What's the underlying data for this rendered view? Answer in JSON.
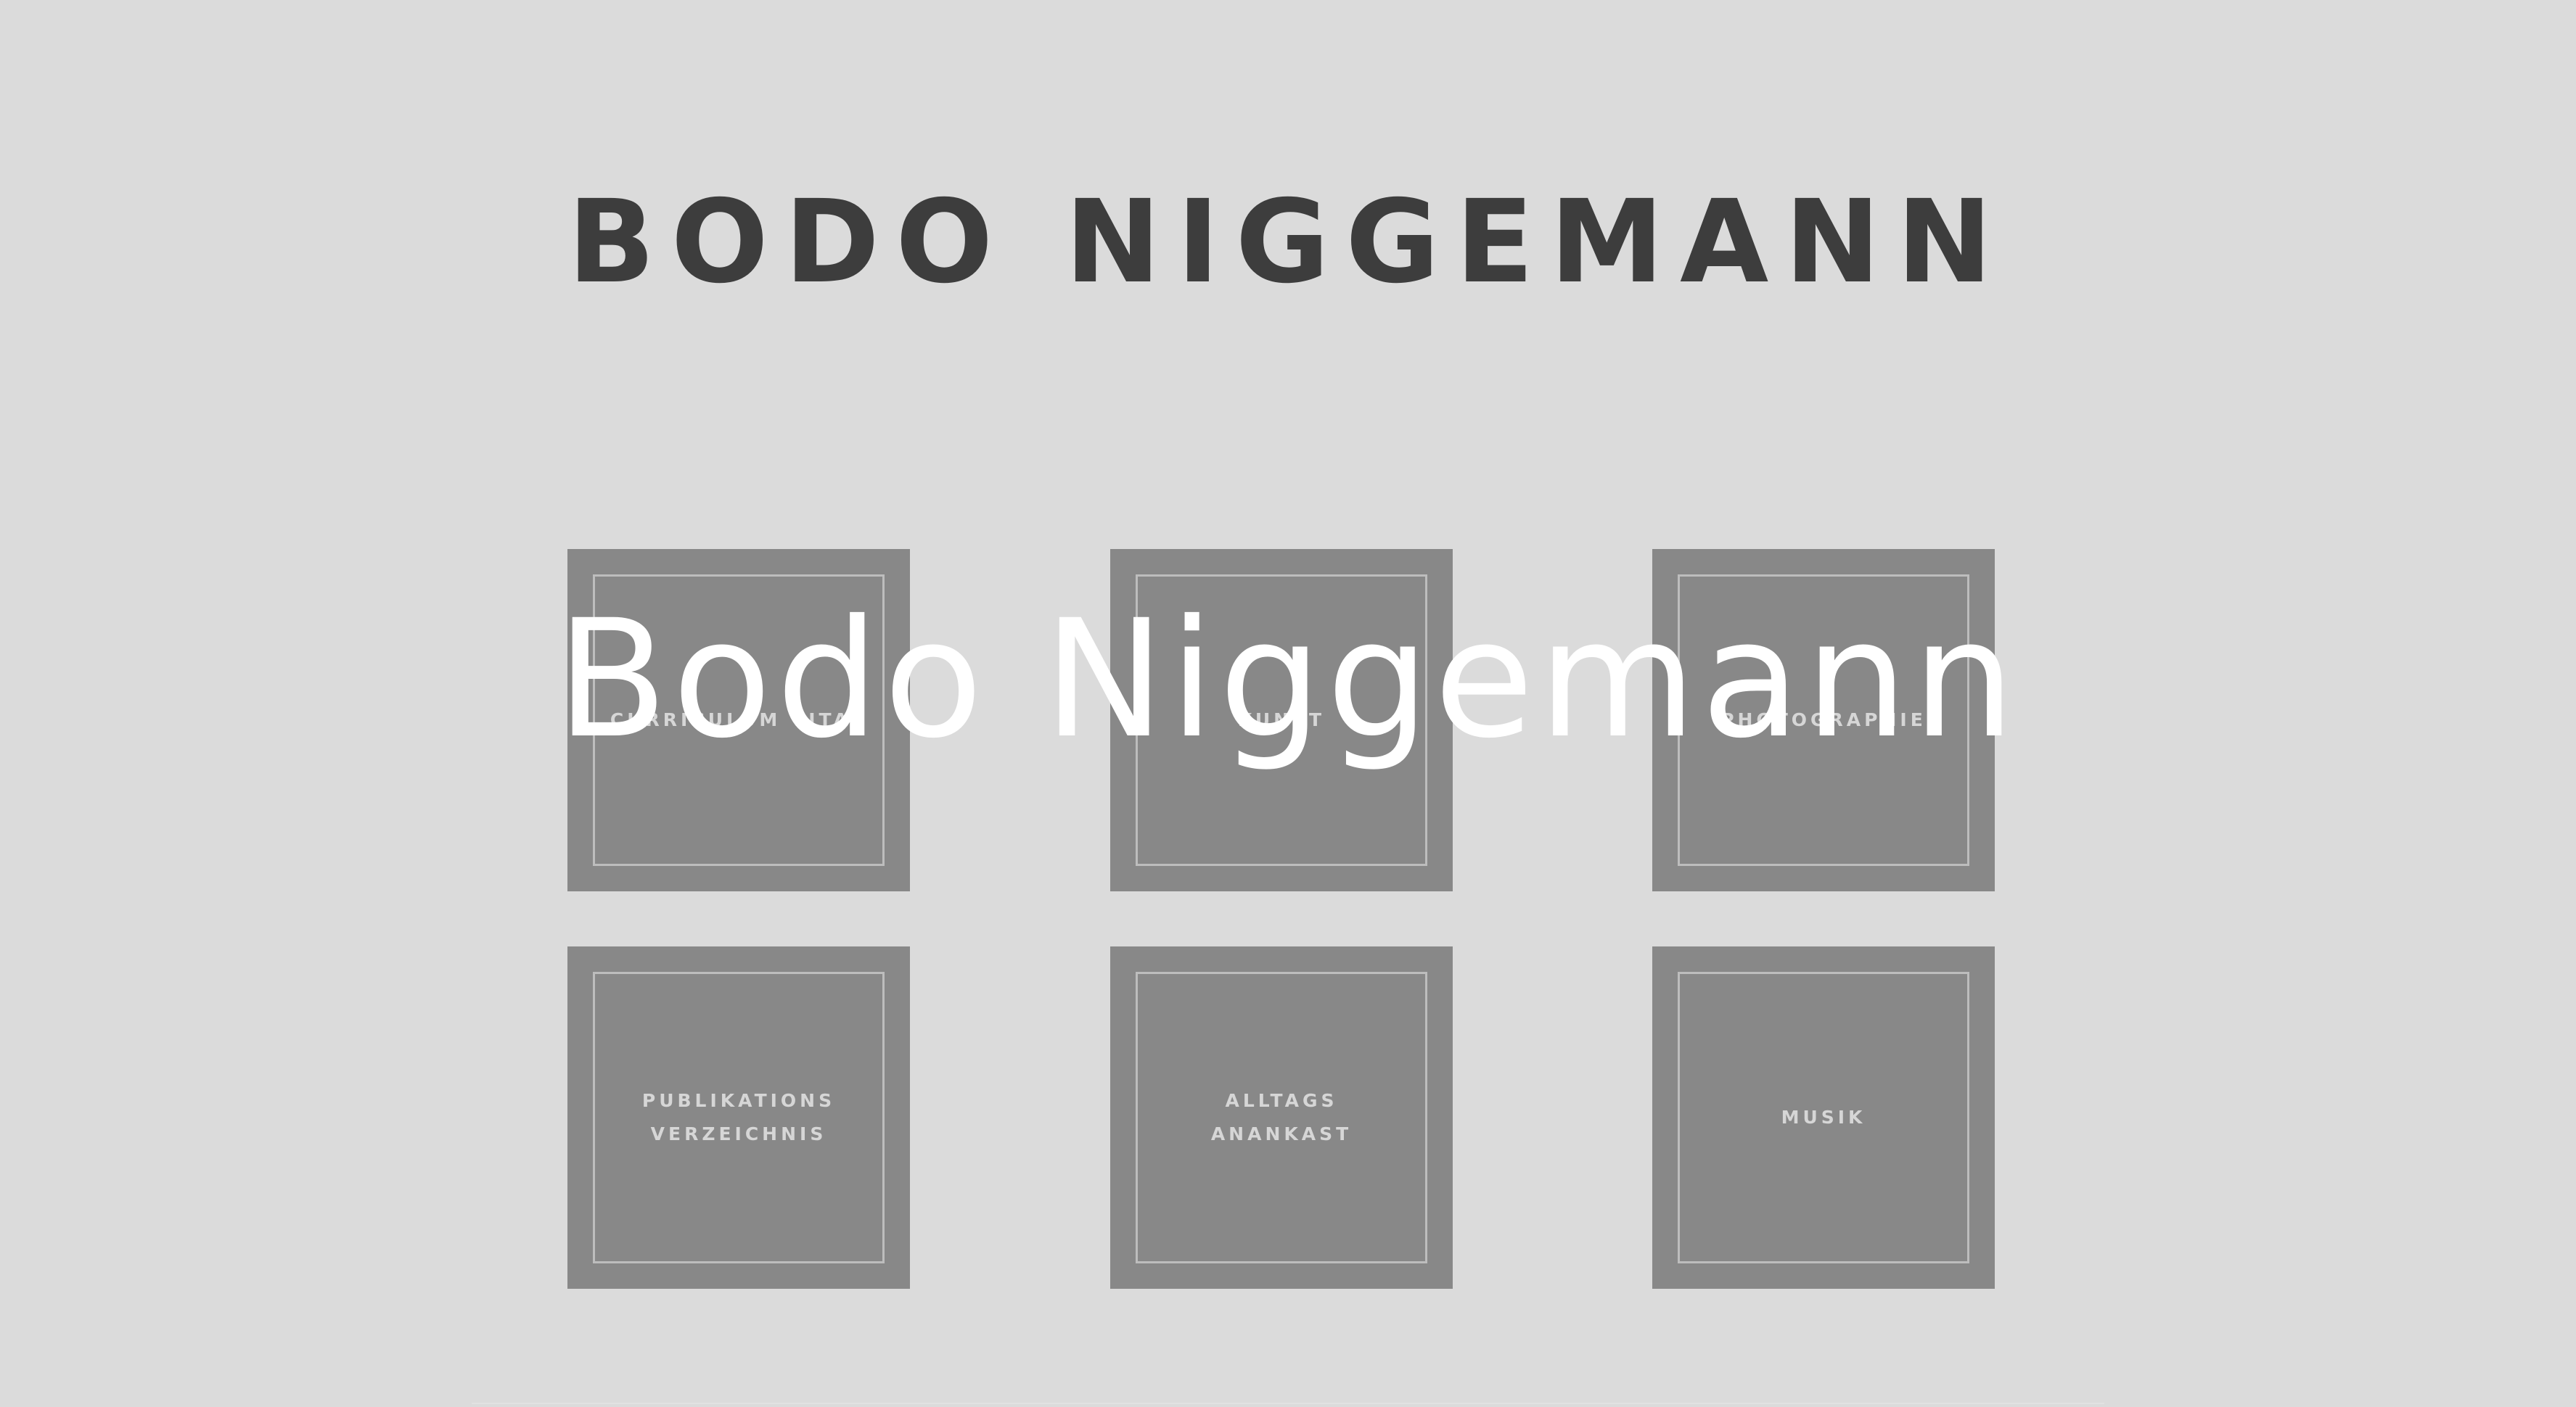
{
  "header": {
    "title": "BODO NIGGEMANN"
  },
  "overlay": {
    "text": "Bodo Niggemann"
  },
  "tiles": [
    {
      "label": "CURRICULUM VITAE"
    },
    {
      "label": "KUNST"
    },
    {
      "label": "PHOTOGRAPHIE"
    },
    {
      "label_lines": [
        "PUBLIKATIONS",
        "VERZEICHNIS"
      ]
    },
    {
      "label": "ALLTAGS ANANKAST"
    },
    {
      "label": "MUSIK"
    }
  ],
  "colors": {
    "background": "#dbdbdb",
    "tile": "#888888",
    "tile_frame": "#bdbdbd",
    "tile_text": "#d6d6d6",
    "header_text": "#3d3d3d",
    "overlay_text": "#ffffff"
  }
}
